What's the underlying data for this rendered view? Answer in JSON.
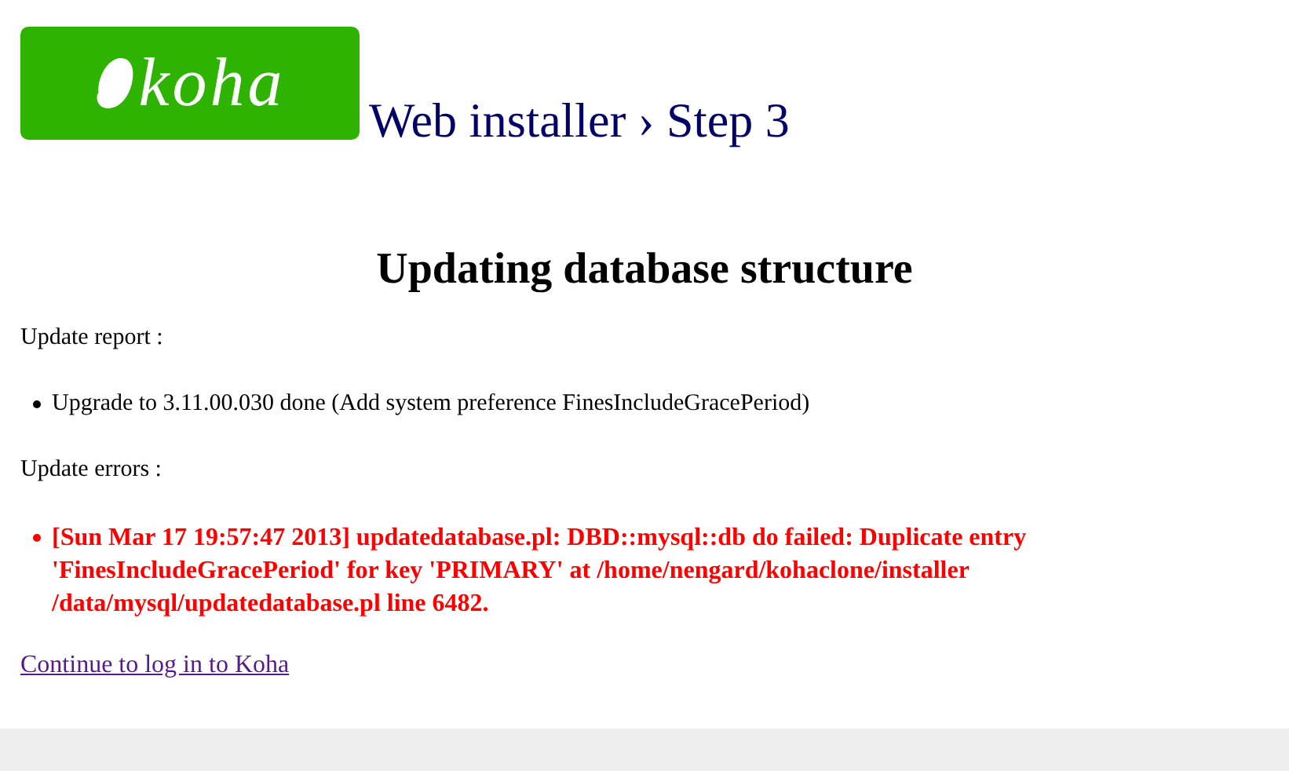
{
  "header": {
    "logo_text": "koha",
    "title": "Web installer › Step 3"
  },
  "heading": "Updating database structure",
  "report": {
    "label": "Update report :",
    "items": [
      "Upgrade to 3.11.00.030 done (Add system preference FinesIncludeGracePeriod)"
    ]
  },
  "errors": {
    "label": "Update errors :",
    "items": [
      "[Sun Mar 17 19:57:47 2013] updatedatabase.pl: DBD::mysql::db do failed: Duplicate entry 'FinesIncludeGracePeriod' for key 'PRIMARY' at /home/nengard/kohaclone/installer /data/mysql/updatedatabase.pl line 6482."
    ]
  },
  "link": "Continue to log in to Koha"
}
